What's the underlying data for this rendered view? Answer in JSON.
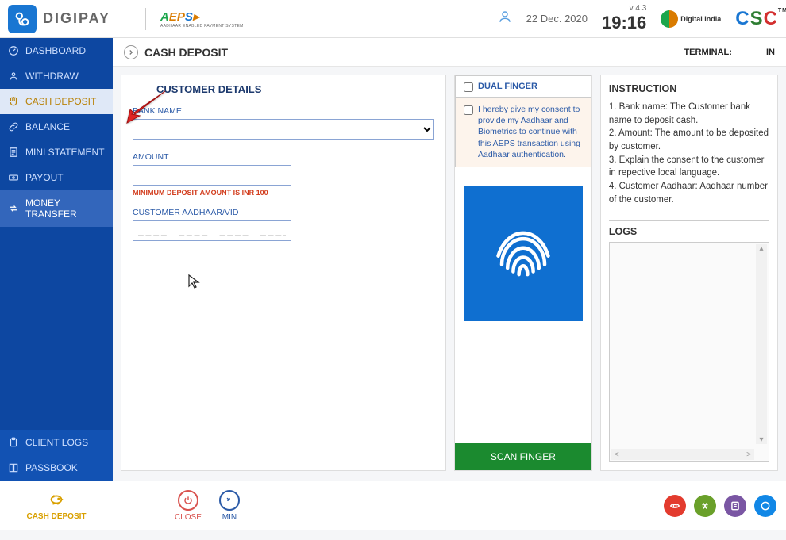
{
  "header": {
    "brand": "DIGIPAY",
    "aeps": "AEPS",
    "aeps_sub": "AADHAAR ENABLED PAYMENT SYSTEM",
    "date": "22 Dec. 2020",
    "version": "v 4.3",
    "time": "19:16",
    "digital_india": "Digital India",
    "csc": "CSC",
    "tm": "TM"
  },
  "sidebar": {
    "items": [
      {
        "label": "DASHBOARD",
        "icon": "gauge-icon"
      },
      {
        "label": "WITHDRAW",
        "icon": "user-icon"
      },
      {
        "label": "CASH DEPOSIT",
        "icon": "hand-icon",
        "active": true
      },
      {
        "label": "BALANCE",
        "icon": "link-icon"
      },
      {
        "label": "MINI STATEMENT",
        "icon": "doc-icon"
      },
      {
        "label": "PAYOUT",
        "icon": "cash-icon"
      },
      {
        "label": "MONEY TRANSFER",
        "icon": "transfer-icon",
        "highlight": true
      }
    ],
    "bottom": [
      {
        "label": "CLIENT LOGS",
        "icon": "clipboard-icon"
      },
      {
        "label": "PASSBOOK",
        "icon": "book-icon"
      }
    ]
  },
  "page": {
    "title": "CASH DEPOSIT",
    "terminal_label": "TERMINAL:",
    "terminal_value": "",
    "inout": "IN"
  },
  "form": {
    "section_title": "CUSTOMER DETAILS",
    "bank_label": "BANK NAME",
    "bank_value": "",
    "amount_label": "AMOUNT",
    "amount_value": "",
    "amount_hint": "MINIMUM DEPOSIT AMOUNT IS INR 100",
    "aadhaar_label": "CUSTOMER AADHAAR/VID",
    "aadhaar_value": ""
  },
  "mid": {
    "dual": "DUAL FINGER",
    "consent": "I hereby give my consent to provide my Aadhaar and Biometrics to continue with this AEPS transaction using Aadhaar authentication.",
    "scan": "SCAN FINGER"
  },
  "right": {
    "instr_title": "INSTRUCTION",
    "instructions": "1. Bank name: The Customer bank name to deposit cash.\n2. Amount: The amount to be deposited by customer.\n3. Explain the consent to the customer in repective local language.\n4. Customer Aadhaar: Aadhaar number of the customer.",
    "logs_title": "LOGS"
  },
  "bottom": {
    "active_label": "CASH DEPOSIT",
    "close": "CLOSE",
    "min": "MIN"
  }
}
